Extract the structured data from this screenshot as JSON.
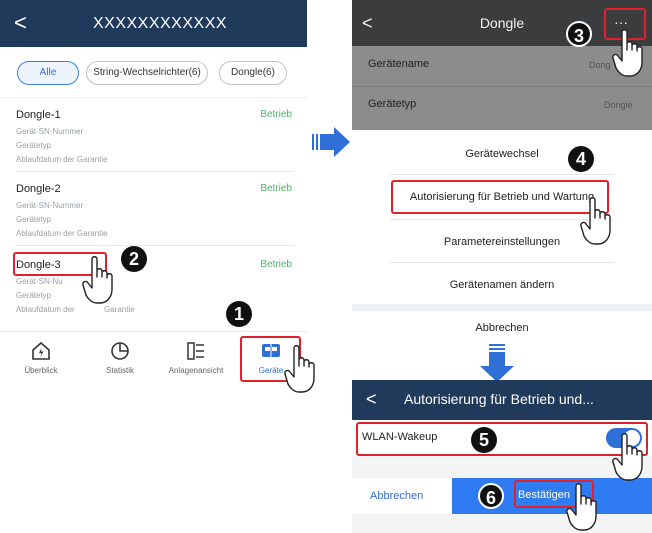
{
  "left": {
    "header": {
      "back": "<",
      "title": "XXXXXXXXXXXX"
    },
    "chips": [
      "Alle",
      "String-Wechselrichter(6)",
      "Dongle(6)"
    ],
    "devices": [
      {
        "name": "Dongle-1",
        "status": "Betrieb",
        "lines": [
          "Gerät-SN-Nummer",
          "Gerätetyp",
          "Ablaufdatum der Garantie"
        ]
      },
      {
        "name": "Dongle-2",
        "status": "Betrieb",
        "lines": [
          "Gerät-SN-Nummer",
          "Gerätetyp",
          "Ablaufdatum der Garantie"
        ]
      },
      {
        "name": "Dongle-3",
        "status": "Betrieb",
        "lines": [
          "Gerät-SN-Nu",
          "Gerätetyp",
          "Ablaufdatum der"
        ]
      }
    ],
    "device3_line3_tail": "Garantie",
    "nav": [
      "Überblick",
      "Statistik",
      "Anlagenansicht",
      "Geräte"
    ]
  },
  "right_top": {
    "back": "<",
    "title": "Dongle",
    "more": "···",
    "rows": [
      {
        "label": "Gerätename",
        "value": "Dong"
      },
      {
        "label": "Gerätetyp",
        "value": "Dongle"
      }
    ],
    "sheet_items": [
      "Gerätewechsel",
      "Autorisierung für Betrieb und Wartung",
      "Parametereinstellungen",
      "Gerätenamen ändern"
    ],
    "cancel": "Abbrechen"
  },
  "right_bottom": {
    "back": "<",
    "title": "Autorisierung für Betrieb und...",
    "row_label": "WLAN-Wakeup",
    "toggle_on": true,
    "cancel": "Abbrechen",
    "confirm": "Bestätigen"
  },
  "steps": [
    "1",
    "2",
    "3",
    "4",
    "5",
    "6"
  ],
  "colors": {
    "header_dark": "#1f3a5a",
    "accent_blue": "#2f6fd6",
    "status_green": "#52b36a",
    "highlight_red": "#e0202a"
  },
  "icons": [
    "overview-home-icon",
    "statistics-pie-icon",
    "plant-view-icon",
    "devices-icon",
    "hand-pointer-icon",
    "arrow-right-icon",
    "arrow-down-icon"
  ]
}
